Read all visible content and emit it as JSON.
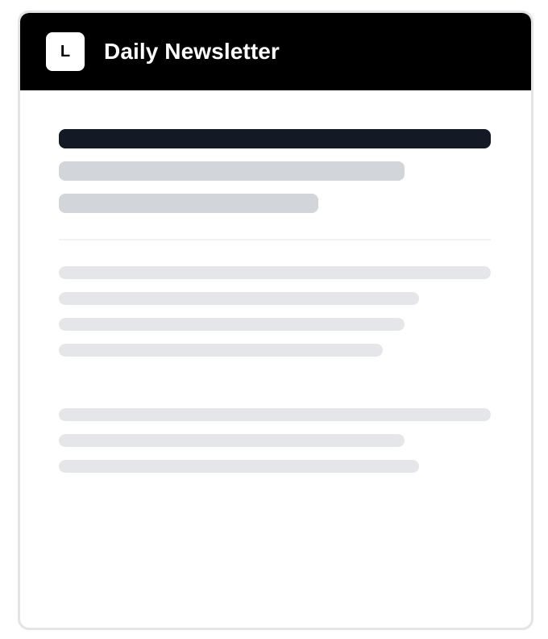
{
  "header": {
    "logo_letter": "L",
    "title": "Daily Newsletter"
  },
  "skeleton": {
    "headline_lines": 1,
    "subheading_lines": 2,
    "paragraphs": [
      {
        "lines": 4
      },
      {
        "lines": 3
      }
    ]
  },
  "colors": {
    "header_bg": "#000000",
    "headline_placeholder": "#131925",
    "subheading_placeholder": "#d2d5d9",
    "body_placeholder": "#e5e6e9",
    "card_border": "#e3e4e7"
  }
}
